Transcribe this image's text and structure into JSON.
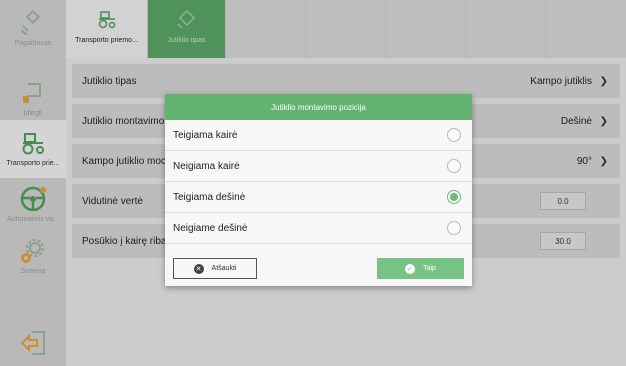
{
  "sidebar": {
    "items": [
      {
        "label": "Pagalbovas",
        "icon": "satellite-icon"
      },
      {
        "label": "Įdiegti",
        "icon": "field-boundary-icon"
      },
      {
        "label": "Transporto prie...",
        "icon": "tractor-icon"
      },
      {
        "label": "Automatinis va...",
        "icon": "steering-wheel-icon"
      },
      {
        "label": "Sistema",
        "icon": "gear-icon"
      }
    ],
    "exit_icon": "exit-icon"
  },
  "tabs": [
    {
      "label": "Transporto priemo...",
      "icon": "tractor-icon"
    },
    {
      "label": "Jutiklio tipas",
      "icon": "sensor-icon"
    }
  ],
  "rows": [
    {
      "label": "Jutiklio tipas",
      "value": "Kampo jutiklis"
    },
    {
      "label": "Jutiklio montavimo",
      "value": "Dešinė"
    },
    {
      "label": "Kampo jutiklio moc",
      "value": "90°"
    },
    {
      "label": "Vidutinė vertė",
      "value": "0.0"
    },
    {
      "label": "Posūkio į kairę riba",
      "value": "30.0"
    }
  ],
  "dialog": {
    "title": "Jutiklio montavimo pozicija",
    "options": [
      {
        "label": "Teigiama kairė",
        "selected": false
      },
      {
        "label": "Neigiama kairė",
        "selected": false
      },
      {
        "label": "Teigiama dešinė",
        "selected": true
      },
      {
        "label": "Neigiame dešinė",
        "selected": false
      }
    ],
    "cancel_label": "Atšaukti",
    "ok_label": "Taip"
  },
  "colors": {
    "accent": "#63b270",
    "ok_button": "#77c384",
    "sidebar_bg": "#d3d3d3"
  }
}
